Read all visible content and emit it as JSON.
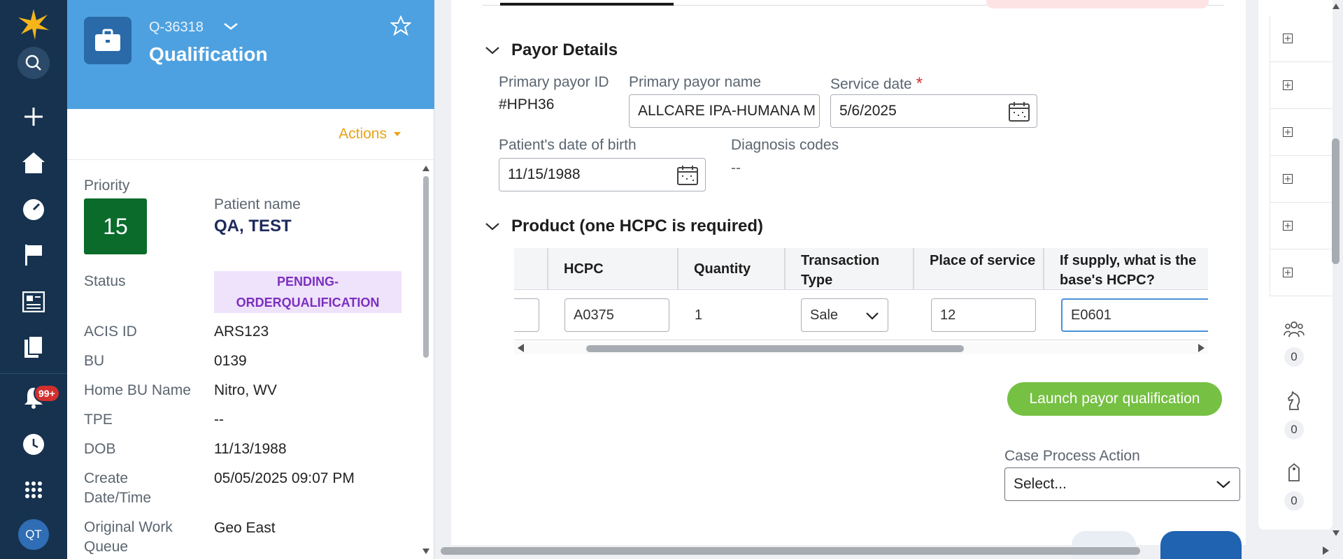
{
  "rail": {
    "notification_badge": "99+",
    "avatar_initials": "QT",
    "icons": [
      "logo-icon",
      "search-icon",
      "plus-icon",
      "home-icon",
      "dashboard-icon",
      "flag-icon",
      "news-icon",
      "documents-icon",
      "bell-icon",
      "history-icon",
      "apps-grid-icon"
    ]
  },
  "case": {
    "id": "Q-36318",
    "title": "Qualification",
    "actions_label": "Actions",
    "priority_label": "Priority",
    "priority_value": "15",
    "patient_name_label": "Patient name",
    "patient_name": "QA, TEST",
    "status_label": "Status",
    "status_value_line1": "PENDING-",
    "status_value_line2": "ORDERQUALIFICATION",
    "fields": [
      {
        "label": "ACIS ID",
        "value": "ARS123"
      },
      {
        "label": "BU",
        "value": "0139"
      },
      {
        "label": "Home BU Name",
        "value": "Nitro, WV"
      },
      {
        "label": "TPE",
        "value": "--"
      },
      {
        "label": "DOB",
        "value": "11/13/1988"
      },
      {
        "label": "Create Date/Time",
        "value": "05/05/2025 09:07 PM"
      },
      {
        "label": "Original Work Queue",
        "value": "Geo East"
      }
    ]
  },
  "payor": {
    "heading": "Payor Details",
    "primary_payor_id_label": "Primary payor ID",
    "primary_payor_id": "#HPH36",
    "primary_payor_name_label": "Primary payor name",
    "primary_payor_name": "ALLCARE IPA-HUMANA M",
    "service_date_label": "Service date",
    "service_date_required": "*",
    "service_date": "5/6/2025",
    "dob_label": "Patient's date of birth",
    "dob": "11/15/1988",
    "diagnosis_label": "Diagnosis codes",
    "diagnosis_value": "--"
  },
  "product": {
    "heading": "Product (one HCPC is required)",
    "columns": [
      "HCPC",
      "Quantity",
      "Transaction Type",
      "Place of service",
      "If supply, what is the base's HCPC?"
    ],
    "row": {
      "hcpc": "A0375",
      "quantity": "1",
      "transaction_type": "Sale",
      "place_of_service": "12",
      "base_hcpc": "E0601"
    }
  },
  "launch_button": "Launch payor qualification",
  "case_process": {
    "label": "Case Process Action",
    "selected": "Select..."
  },
  "utility": {
    "counts": [
      "0",
      "0",
      "0"
    ]
  }
}
